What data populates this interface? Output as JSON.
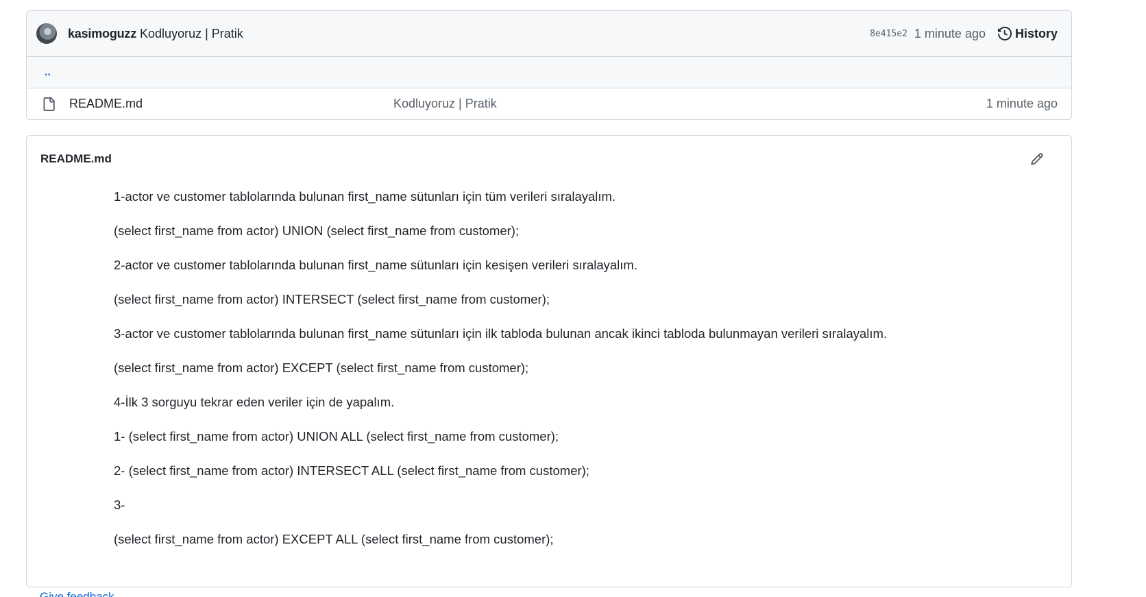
{
  "commit": {
    "author": "kasimoguzz",
    "message": "Kodluyoruz | Pratik",
    "sha": "8e415e2",
    "time": "1 minute ago",
    "history_label": "History"
  },
  "file_list": {
    "parent_dir": "..",
    "files": [
      {
        "name": "README.md",
        "message": "Kodluyoruz | Pratik",
        "time": "1 minute ago",
        "icon": "file-icon"
      }
    ]
  },
  "readme": {
    "title": "README.md",
    "paragraphs": [
      "1-actor ve customer tablolarında bulunan first_name sütunları için tüm verileri sıralayalım.",
      "(select first_name from actor) UNION (select first_name from customer);",
      "2-actor ve customer tablolarında bulunan first_name sütunları için kesişen verileri sıralayalım.",
      "(select first_name from actor) INTERSECT (select first_name from customer);",
      "3-actor ve customer tablolarında bulunan first_name sütunları için ilk tabloda bulunan ancak ikinci tabloda bulunmayan verileri sıralayalım.",
      "(select first_name from actor) EXCEPT (select first_name from customer);",
      "4-İlk 3 sorguyu tekrar eden veriler için de yapalım.",
      "1- (select first_name from actor) UNION ALL (select first_name from customer);",
      "2- (select first_name from actor) INTERSECT ALL (select first_name from customer);",
      "3-",
      "(select first_name from actor) EXCEPT ALL (select first_name from customer);"
    ]
  },
  "footer": {
    "feedback_link": "Give feedback"
  },
  "colors": {
    "accent": "#0969da",
    "muted": "#57606a",
    "border": "#d0d7de",
    "header_bg": "#f6f8fa"
  }
}
